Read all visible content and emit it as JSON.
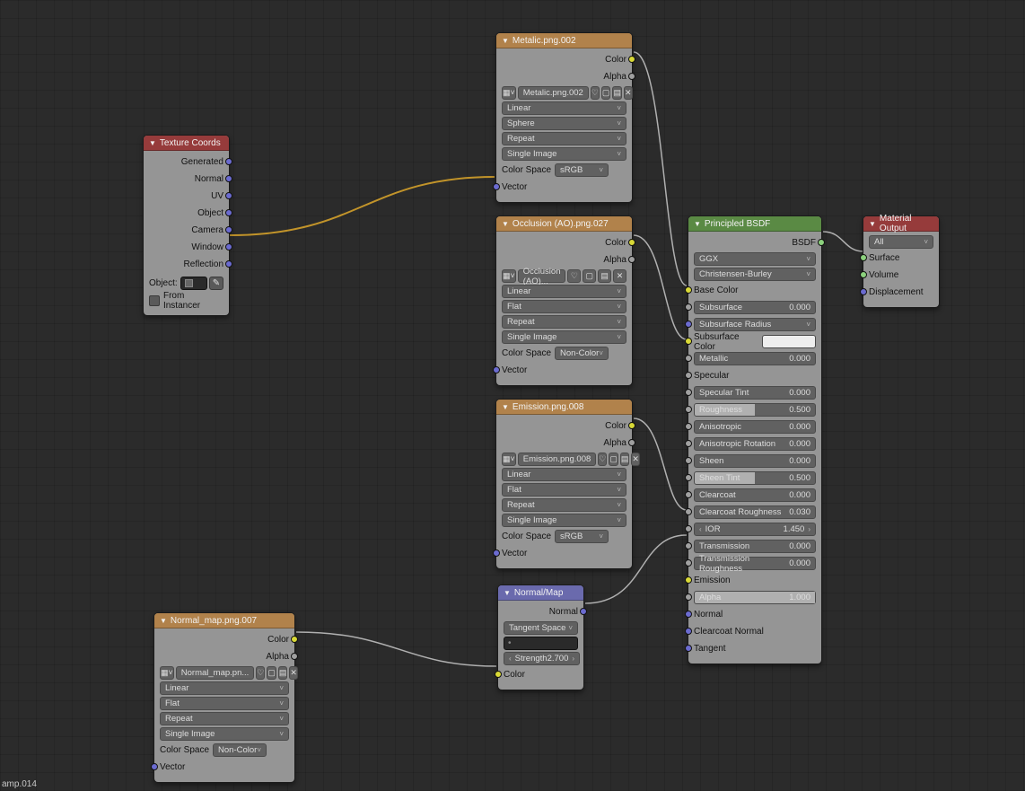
{
  "bottomLabel": "amp.014",
  "texcoord": {
    "title": "Texture Coords",
    "outputs": [
      "Generated",
      "Normal",
      "UV",
      "Object",
      "Camera",
      "Window",
      "Reflection"
    ],
    "objectLabel": "Object:",
    "fromInstancer": "From Instancer"
  },
  "tex_metalic": {
    "title": "Metalic.png.002",
    "out_color": "Color",
    "out_alpha": "Alpha",
    "imageName": "Metalic.png.002",
    "interp": "Linear",
    "projection": "Sphere",
    "extension": "Repeat",
    "source": "Single Image",
    "colorSpaceLabel": "Color Space",
    "colorSpace": "sRGB",
    "in_vector": "Vector"
  },
  "tex_ao": {
    "title": "Occlusion (AO).png.027",
    "out_color": "Color",
    "out_alpha": "Alpha",
    "imageName": "Occlusion (AO)...",
    "interp": "Linear",
    "projection": "Flat",
    "extension": "Repeat",
    "source": "Single Image",
    "colorSpaceLabel": "Color Space",
    "colorSpace": "Non-Color",
    "in_vector": "Vector"
  },
  "tex_emission": {
    "title": "Emission.png.008",
    "out_color": "Color",
    "out_alpha": "Alpha",
    "imageName": "Emission.png.008",
    "interp": "Linear",
    "projection": "Flat",
    "extension": "Repeat",
    "source": "Single Image",
    "colorSpaceLabel": "Color Space",
    "colorSpace": "sRGB",
    "in_vector": "Vector"
  },
  "tex_normal": {
    "title": "Normal_map.png.007",
    "out_color": "Color",
    "out_alpha": "Alpha",
    "imageName": "Normal_map.pn...",
    "interp": "Linear",
    "projection": "Flat",
    "extension": "Repeat",
    "source": "Single Image",
    "colorSpaceLabel": "Color Space",
    "colorSpace": "Non-Color",
    "in_vector": "Vector"
  },
  "normalmap": {
    "title": "Normal/Map",
    "out_normal": "Normal",
    "space": "Tangent Space",
    "uvPlaceholder": "",
    "strengthLabel": "Strength",
    "strengthValue": "2.700",
    "in_color": "Color"
  },
  "bsdf": {
    "title": "Principled BSDF",
    "out_bsdf": "BSDF",
    "distribution": "GGX",
    "subsurfMethod": "Christensen-Burley",
    "baseColor": "Base Color",
    "subsurface": {
      "label": "Subsurface",
      "value": "0.000"
    },
    "subsurfRadius": "Subsurface Radius",
    "subsurfColor": "Subsurface Color",
    "metallic": {
      "label": "Metallic",
      "value": "0.000"
    },
    "specular": "Specular",
    "specularTint": {
      "label": "Specular Tint",
      "value": "0.000"
    },
    "roughness": {
      "label": "Roughness",
      "value": "0.500"
    },
    "anisotropic": {
      "label": "Anisotropic",
      "value": "0.000"
    },
    "anisotropicRot": {
      "label": "Anisotropic Rotation",
      "value": "0.000"
    },
    "sheen": {
      "label": "Sheen",
      "value": "0.000"
    },
    "sheenTint": {
      "label": "Sheen Tint",
      "value": "0.500"
    },
    "clearcoat": {
      "label": "Clearcoat",
      "value": "0.000"
    },
    "clearcoatRough": {
      "label": "Clearcoat Roughness",
      "value": "0.030"
    },
    "ior": {
      "label": "IOR",
      "value": "1.450"
    },
    "transmission": {
      "label": "Transmission",
      "value": "0.000"
    },
    "transmissionRough": {
      "label": "Transmission Roughness",
      "value": "0.000"
    },
    "emission": "Emission",
    "alpha": {
      "label": "Alpha",
      "value": "1.000"
    },
    "normal": "Normal",
    "clearcoatNormal": "Clearcoat Normal",
    "tangent": "Tangent"
  },
  "matout": {
    "title": "Material Output",
    "target": "All",
    "surface": "Surface",
    "volume": "Volume",
    "displacement": "Displacement"
  }
}
